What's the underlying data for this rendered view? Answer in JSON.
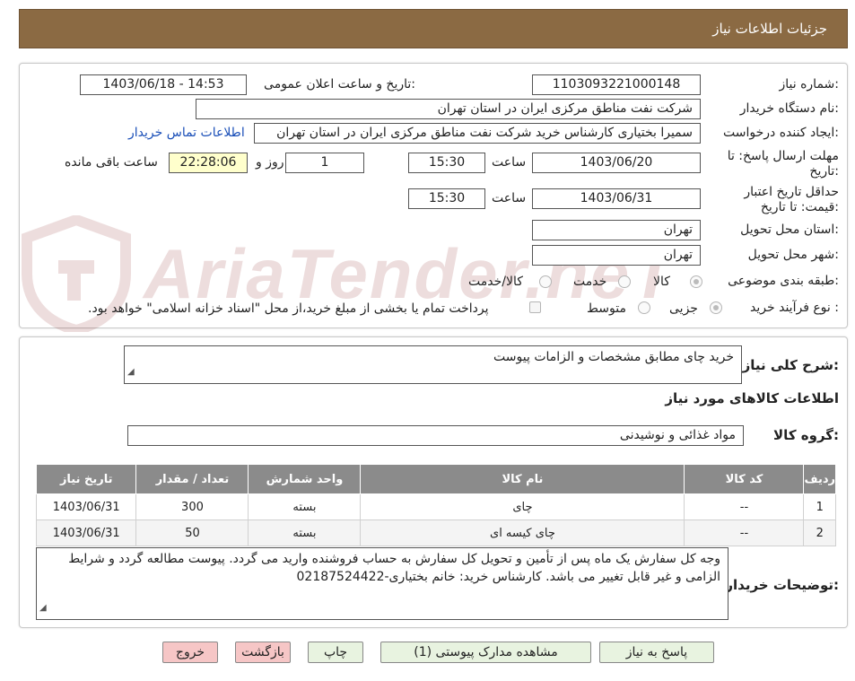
{
  "header": {
    "title": "جزئیات اطلاعات نیاز"
  },
  "watermark": {
    "text": "AriaTender.neT"
  },
  "form": {
    "need_number_label": "شماره نیاز:",
    "need_number": "1103093221000148",
    "announce_label": "تاریخ و ساعت اعلان عمومی:",
    "announce_value": "1403/06/18 - 14:53",
    "buyer_org_label": "نام دستگاه خریدار:",
    "buyer_org": "شرکت نفت مناطق مرکزی ایران در استان تهران",
    "creator_label": "ایجاد کننده درخواست:",
    "creator": "سمیرا بختیاری کارشناس خرید شرکت نفت مناطق مرکزی ایران در استان تهران",
    "contact_link": "اطلاعات تماس خریدار",
    "reply_deadline_label_1": "مهلت ارسال پاسخ: تا",
    "reply_deadline_label_2": "تاریخ:",
    "reply_date": "1403/06/20",
    "time_label": "ساعت",
    "reply_time": "15:30",
    "days_value": "1",
    "days_label": "روز و",
    "remaining_time": "22:28:06",
    "remaining_label": "ساعت باقی مانده",
    "validity_label_1": "حداقل تاریخ اعتبار",
    "validity_label_2": "قیمت: تا تاریخ:",
    "validity_date": "1403/06/31",
    "validity_time_label": "ساعت",
    "validity_time": "15:30",
    "province_label": "استان محل تحویل:",
    "province": "تهران",
    "city_label": "شهر محل تحویل:",
    "city": "تهران",
    "category_label": "طبقه بندی موضوعی:",
    "category_options": [
      "کالا",
      "خدمت",
      "کالا/خدمت"
    ],
    "purchase_type_label": "نوع فرآیند خرید :",
    "purchase_type_options": [
      "جزیی",
      "متوسط"
    ],
    "payment_note": "پرداخت تمام یا بخشی از مبلغ خرید،از محل \"اسناد خزانه اسلامی\" خواهد بود."
  },
  "summary": {
    "general_desc_label": "شرح کلی نیاز:",
    "general_desc": "خرید چای مطابق مشخصات و الزامات پیوست",
    "goods_info_title": "اطلاعات کالاهای مورد نیاز",
    "goods_group_label": "گروه کالا:",
    "goods_group": "مواد غذائی و نوشیدنی",
    "table": {
      "headers": [
        "ردیف",
        "کد کالا",
        "نام کالا",
        "واحد شمارش",
        "تعداد / مقدار",
        "تاریخ نیاز"
      ],
      "rows": [
        [
          "1",
          "--",
          "چای",
          "بسته",
          "300",
          "1403/06/31"
        ],
        [
          "2",
          "--",
          "چای کیسه ای",
          "بسته",
          "50",
          "1403/06/31"
        ]
      ]
    },
    "buyer_notes_label": "توضیحات خریدار:",
    "buyer_notes": "وجه کل سفارش یک ماه پس از تأمین و تحویل کل سفارش به حساب فروشنده وارید می گردد. پیوست مطالعه گردد و شرایط الزامی و غیر قابل تغییر می باشد. کارشناس خرید: خانم بختیاری-02187524422"
  },
  "buttons": {
    "reply": "پاسخ به نیاز",
    "attachments": "مشاهده مدارک پیوستی (1)",
    "print": "چاپ",
    "back": "بازگشت",
    "exit": "خروج"
  }
}
